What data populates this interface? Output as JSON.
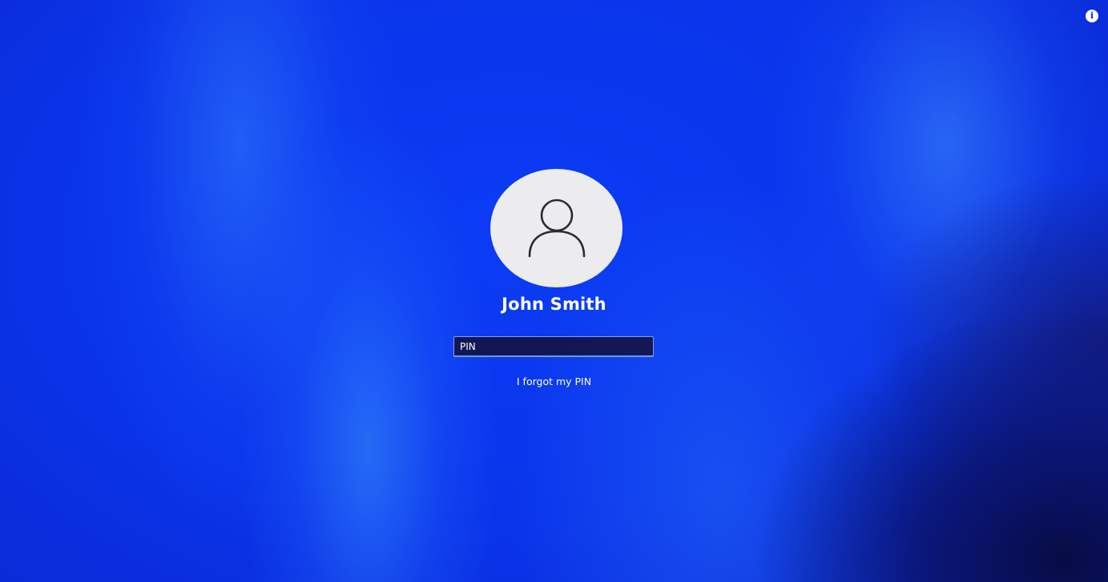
{
  "user": {
    "name": "John Smith"
  },
  "pin_field": {
    "placeholder": "PIN",
    "value": ""
  },
  "links": {
    "forgot_pin": "I forgot my PIN"
  },
  "icons": {
    "info": "info-icon",
    "avatar": "user-silhouette-icon"
  },
  "colors": {
    "background_accent": "#0a2fe8",
    "avatar_bg": "#ecebee",
    "input_bg": "#141446",
    "input_border": "#6f96ff",
    "text": "#ffffff"
  }
}
